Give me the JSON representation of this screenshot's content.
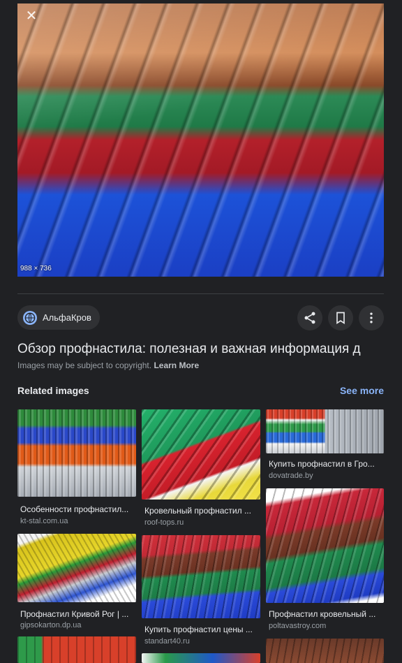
{
  "hero": {
    "close_glyph": "✕",
    "dimensions": "988 × 736"
  },
  "source": {
    "name": "АльфаКров",
    "icon": "globe-icon"
  },
  "actions": {
    "share_icon": "share-icon",
    "save_icon": "bookmark-icon",
    "more_icon": "more-vert-icon"
  },
  "result": {
    "title": "Обзор профнастила: полезная и важная информация д",
    "copyright_text": "Images may be subject to copyright.",
    "learn_more": "Learn More"
  },
  "related": {
    "heading": "Related images",
    "see_more": "See more",
    "items": [
      {
        "caption": "Особенности профнастил...",
        "domain": "kt-stal.com.ua"
      },
      {
        "caption": "Кровельный профнастил ...",
        "domain": "roof-tops.ru"
      },
      {
        "caption": "Купить профнастил в Гро...",
        "domain": "dovatrade.by"
      },
      {
        "caption": "Профнастил Кривой Рог | ...",
        "domain": "gipsokarton.dp.ua"
      },
      {
        "caption": "Купить профнастил цены ...",
        "domain": "standart40.ru"
      },
      {
        "caption": "Профнастил кровельный ...",
        "domain": "poltavastroy.com"
      }
    ]
  },
  "colors": {
    "background": "#202124",
    "accent": "#8ab4f8",
    "surface": "#303134"
  }
}
